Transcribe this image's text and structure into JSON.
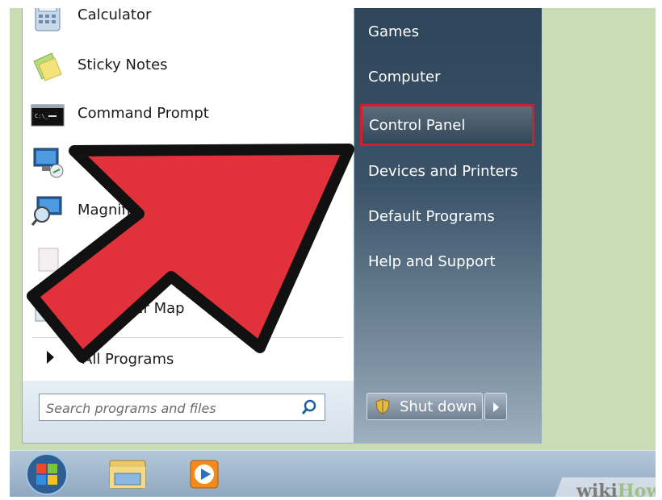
{
  "start_menu": {
    "programs": [
      {
        "label": "Calculator",
        "icon": "calculator-icon"
      },
      {
        "label": "Sticky Notes",
        "icon": "sticky-notes-icon"
      },
      {
        "label": "Command Prompt",
        "icon": "command-prompt-icon"
      },
      {
        "label": "",
        "icon": "remote-desktop-icon"
      },
      {
        "label": "Magnifier",
        "icon": "magnifier-icon"
      },
      {
        "label": "",
        "icon": "program-icon"
      },
      {
        "label": "Character Map",
        "icon": "character-map-icon"
      }
    ],
    "all_programs_label": "All Programs",
    "search_placeholder": "Search programs and files",
    "right_items": [
      "Games",
      "Computer",
      "Control Panel",
      "Devices and Printers",
      "Default Programs",
      "Help and Support"
    ],
    "highlighted_item": "Control Panel",
    "shutdown_label": "Shut down"
  },
  "taskbar": {
    "items": [
      "start-orb",
      "windows-explorer-icon",
      "media-player-icon"
    ]
  },
  "watermark": {
    "wiki": "wiki",
    "how": "How"
  },
  "colors": {
    "highlight": "#d21f2a",
    "arrow": "#e1323c",
    "right_pane": "#3a5267"
  }
}
